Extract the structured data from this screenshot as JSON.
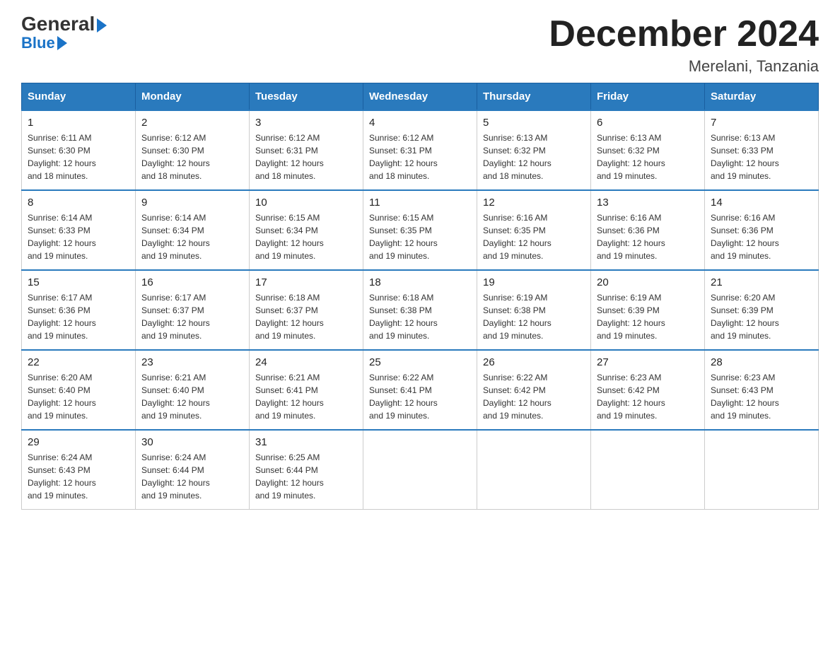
{
  "logo": {
    "general": "General",
    "blue": "Blue"
  },
  "title": "December 2024",
  "location": "Merelani, Tanzania",
  "days_of_week": [
    "Sunday",
    "Monday",
    "Tuesday",
    "Wednesday",
    "Thursday",
    "Friday",
    "Saturday"
  ],
  "weeks": [
    [
      {
        "day": "1",
        "sunrise": "6:11 AM",
        "sunset": "6:30 PM",
        "daylight": "12 hours and 18 minutes."
      },
      {
        "day": "2",
        "sunrise": "6:12 AM",
        "sunset": "6:30 PM",
        "daylight": "12 hours and 18 minutes."
      },
      {
        "day": "3",
        "sunrise": "6:12 AM",
        "sunset": "6:31 PM",
        "daylight": "12 hours and 18 minutes."
      },
      {
        "day": "4",
        "sunrise": "6:12 AM",
        "sunset": "6:31 PM",
        "daylight": "12 hours and 18 minutes."
      },
      {
        "day": "5",
        "sunrise": "6:13 AM",
        "sunset": "6:32 PM",
        "daylight": "12 hours and 18 minutes."
      },
      {
        "day": "6",
        "sunrise": "6:13 AM",
        "sunset": "6:32 PM",
        "daylight": "12 hours and 19 minutes."
      },
      {
        "day": "7",
        "sunrise": "6:13 AM",
        "sunset": "6:33 PM",
        "daylight": "12 hours and 19 minutes."
      }
    ],
    [
      {
        "day": "8",
        "sunrise": "6:14 AM",
        "sunset": "6:33 PM",
        "daylight": "12 hours and 19 minutes."
      },
      {
        "day": "9",
        "sunrise": "6:14 AM",
        "sunset": "6:34 PM",
        "daylight": "12 hours and 19 minutes."
      },
      {
        "day": "10",
        "sunrise": "6:15 AM",
        "sunset": "6:34 PM",
        "daylight": "12 hours and 19 minutes."
      },
      {
        "day": "11",
        "sunrise": "6:15 AM",
        "sunset": "6:35 PM",
        "daylight": "12 hours and 19 minutes."
      },
      {
        "day": "12",
        "sunrise": "6:16 AM",
        "sunset": "6:35 PM",
        "daylight": "12 hours and 19 minutes."
      },
      {
        "day": "13",
        "sunrise": "6:16 AM",
        "sunset": "6:36 PM",
        "daylight": "12 hours and 19 minutes."
      },
      {
        "day": "14",
        "sunrise": "6:16 AM",
        "sunset": "6:36 PM",
        "daylight": "12 hours and 19 minutes."
      }
    ],
    [
      {
        "day": "15",
        "sunrise": "6:17 AM",
        "sunset": "6:36 PM",
        "daylight": "12 hours and 19 minutes."
      },
      {
        "day": "16",
        "sunrise": "6:17 AM",
        "sunset": "6:37 PM",
        "daylight": "12 hours and 19 minutes."
      },
      {
        "day": "17",
        "sunrise": "6:18 AM",
        "sunset": "6:37 PM",
        "daylight": "12 hours and 19 minutes."
      },
      {
        "day": "18",
        "sunrise": "6:18 AM",
        "sunset": "6:38 PM",
        "daylight": "12 hours and 19 minutes."
      },
      {
        "day": "19",
        "sunrise": "6:19 AM",
        "sunset": "6:38 PM",
        "daylight": "12 hours and 19 minutes."
      },
      {
        "day": "20",
        "sunrise": "6:19 AM",
        "sunset": "6:39 PM",
        "daylight": "12 hours and 19 minutes."
      },
      {
        "day": "21",
        "sunrise": "6:20 AM",
        "sunset": "6:39 PM",
        "daylight": "12 hours and 19 minutes."
      }
    ],
    [
      {
        "day": "22",
        "sunrise": "6:20 AM",
        "sunset": "6:40 PM",
        "daylight": "12 hours and 19 minutes."
      },
      {
        "day": "23",
        "sunrise": "6:21 AM",
        "sunset": "6:40 PM",
        "daylight": "12 hours and 19 minutes."
      },
      {
        "day": "24",
        "sunrise": "6:21 AM",
        "sunset": "6:41 PM",
        "daylight": "12 hours and 19 minutes."
      },
      {
        "day": "25",
        "sunrise": "6:22 AM",
        "sunset": "6:41 PM",
        "daylight": "12 hours and 19 minutes."
      },
      {
        "day": "26",
        "sunrise": "6:22 AM",
        "sunset": "6:42 PM",
        "daylight": "12 hours and 19 minutes."
      },
      {
        "day": "27",
        "sunrise": "6:23 AM",
        "sunset": "6:42 PM",
        "daylight": "12 hours and 19 minutes."
      },
      {
        "day": "28",
        "sunrise": "6:23 AM",
        "sunset": "6:43 PM",
        "daylight": "12 hours and 19 minutes."
      }
    ],
    [
      {
        "day": "29",
        "sunrise": "6:24 AM",
        "sunset": "6:43 PM",
        "daylight": "12 hours and 19 minutes."
      },
      {
        "day": "30",
        "sunrise": "6:24 AM",
        "sunset": "6:44 PM",
        "daylight": "12 hours and 19 minutes."
      },
      {
        "day": "31",
        "sunrise": "6:25 AM",
        "sunset": "6:44 PM",
        "daylight": "12 hours and 19 minutes."
      },
      null,
      null,
      null,
      null
    ]
  ],
  "labels": {
    "sunrise": "Sunrise:",
    "sunset": "Sunset:",
    "daylight": "Daylight:"
  }
}
